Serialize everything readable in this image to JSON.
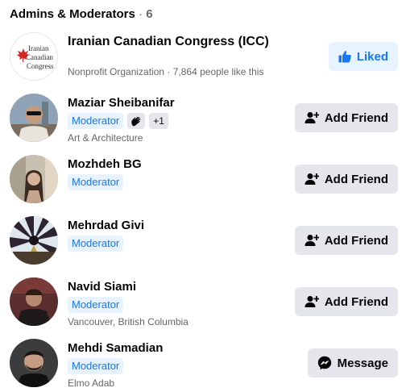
{
  "header": {
    "title": "Admins & Moderators",
    "separator": "·",
    "count": "6"
  },
  "organization": {
    "logo_text": [
      "Iranian",
      "Canadian",
      "Congress"
    ],
    "name": "Iranian Canadian Congress (ICC)",
    "subtitle": "Nonprofit Organization · 7,864 people like this",
    "button_label": "Liked",
    "accent_color": "#1877f2"
  },
  "members": [
    {
      "name": "Maziar Sheibanifar",
      "badge": "Moderator",
      "extra_badge": "+1",
      "sub": "Art & Architecture",
      "button_label": "Add Friend"
    },
    {
      "name": "Mozhdeh BG",
      "badge": "Moderator",
      "sub": "",
      "button_label": "Add Friend"
    },
    {
      "name": "Mehrdad Givi",
      "badge": "Moderator",
      "sub": "",
      "button_label": "Add Friend"
    },
    {
      "name": "Navid Siami",
      "badge": "Moderator",
      "sub": "Vancouver, British Columbia",
      "button_label": "Add Friend"
    },
    {
      "name": "Mehdi Samadian",
      "badge": "Moderator",
      "sub": "Elmo Adab",
      "button_label": "Message"
    }
  ]
}
